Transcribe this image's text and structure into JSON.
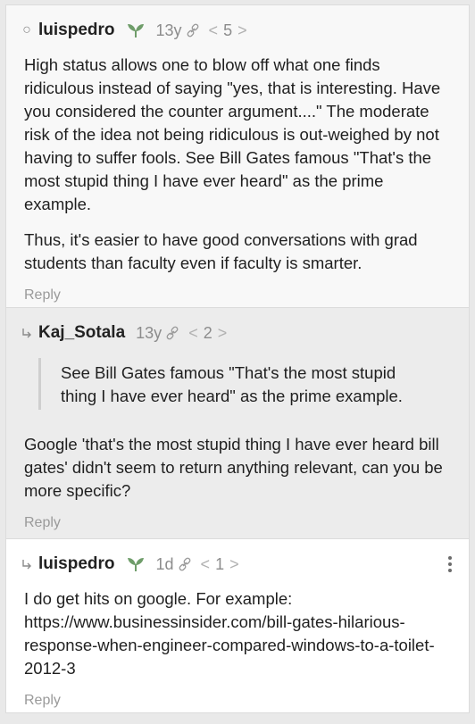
{
  "comments": [
    {
      "author": "luispedro",
      "age": "13y",
      "karma": "5",
      "paragraphs": [
        "High status allows one to blow off what one finds ridiculous instead of saying \"yes, that is interesting. Have you considered the counter argument....\" The moderate risk of the idea not being ridiculous is out-weighed by not having to suffer fools. See Bill Gates famous \"That's the most stupid thing I have ever heard\" as the prime example.",
        "Thus, it's easier to have good conversations with grad students than faculty even if faculty is smarter."
      ],
      "reply_label": "Reply"
    },
    {
      "author": "Kaj_Sotala",
      "age": "13y",
      "karma": "2",
      "quote": "See Bill Gates famous \"That's the most stupid thing I have ever heard\" as the prime example.",
      "paragraphs": [
        "Google 'that's the most stupid thing I have ever heard bill gates' didn't seem to return anything relevant, can you be more specific?"
      ],
      "reply_label": "Reply"
    },
    {
      "author": "luispedro",
      "age": "1d",
      "karma": "1",
      "paragraphs": [
        "I do get hits on google. For example: https://www.businessinsider.com/bill-gates-hilarious-response-when-engineer-compared-windows-to-a-toilet-2012-3"
      ],
      "reply_label": "Reply"
    }
  ],
  "colors": {
    "page_bg": "#e9e9e9",
    "comment_bg": "#f8f8f8",
    "nested_bg": "#ececec",
    "deep_bg": "#ffffff",
    "muted_text": "#8c8c8c",
    "sprout_green": "#6f9d6a"
  },
  "icons": {
    "collapse": "circle-icon",
    "nested": "nested-reply-arrow-icon",
    "new_user": "sprout-icon",
    "permalink": "link-icon",
    "vote_down": "chevron-left-icon",
    "vote_up": "chevron-right-icon",
    "menu": "more-vertical-icon"
  }
}
